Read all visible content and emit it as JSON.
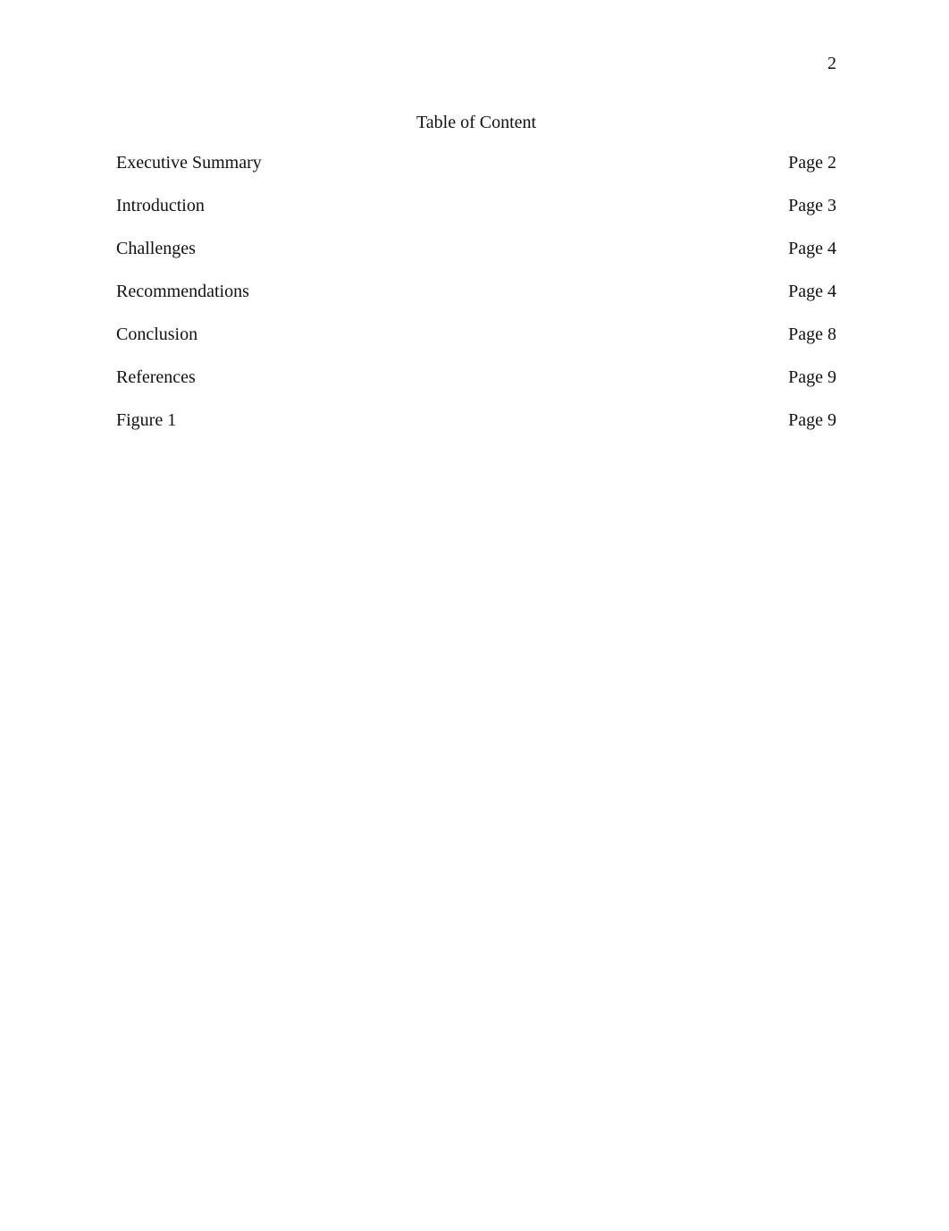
{
  "document": {
    "header_page_number": "2",
    "title": "Table of Content",
    "entries": [
      {
        "label": "Executive Summary",
        "page": "Page 2"
      },
      {
        "label": "Introduction",
        "page": "Page 3"
      },
      {
        "label": "Challenges",
        "page": "Page 4"
      },
      {
        "label": "Recommendations",
        "page": "Page 4"
      },
      {
        "label": "Conclusion",
        "page": "Page 8"
      },
      {
        "label": "References",
        "page": "Page 9"
      },
      {
        "label": "Figure 1",
        "page": "Page 9"
      }
    ]
  },
  "style": {
    "text_color": "#111111",
    "background_color": "#ffffff"
  }
}
